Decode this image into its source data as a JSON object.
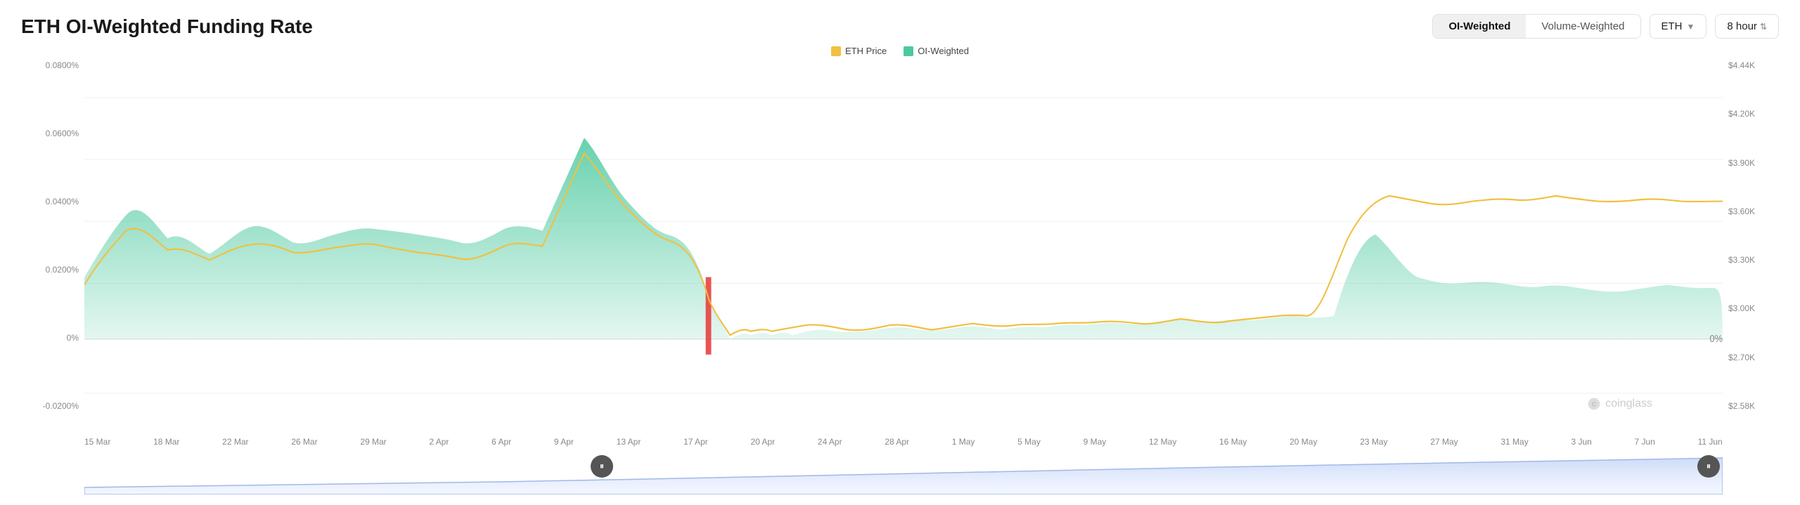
{
  "header": {
    "title": "ETH OI-Weighted Funding Rate"
  },
  "controls": {
    "tab1_label": "OI-Weighted",
    "tab2_label": "Volume-Weighted",
    "asset_label": "ETH",
    "hour_label": "8 hour"
  },
  "legend": {
    "item1_label": "ETH Price",
    "item2_label": "OI-Weighted",
    "item1_color": "#f0c040",
    "item2_color": "#4dc9a0"
  },
  "y_axis_left": {
    "values": [
      "0.0800%",
      "0.0600%",
      "0.0400%",
      "0.0200%",
      "0%",
      "-0.0200%"
    ]
  },
  "y_axis_right": {
    "values": [
      "$4.44K",
      "$4.20K",
      "$3.90K",
      "$3.60K",
      "$3.30K",
      "$3.00K",
      "$2.70K",
      "$2.58K"
    ]
  },
  "x_axis": {
    "labels": [
      "15 Mar",
      "18 Mar",
      "22 Mar",
      "26 Mar",
      "29 Mar",
      "2 Apr",
      "6 Apr",
      "9 Apr",
      "13 Apr",
      "17 Apr",
      "20 Apr",
      "24 Apr",
      "28 Apr",
      "1 May",
      "5 May",
      "9 May",
      "12 May",
      "16 May",
      "20 May",
      "23 May",
      "27 May",
      "31 May",
      "3 Jun",
      "7 Jun",
      "11 Jun"
    ]
  },
  "watermark": "coinglass"
}
